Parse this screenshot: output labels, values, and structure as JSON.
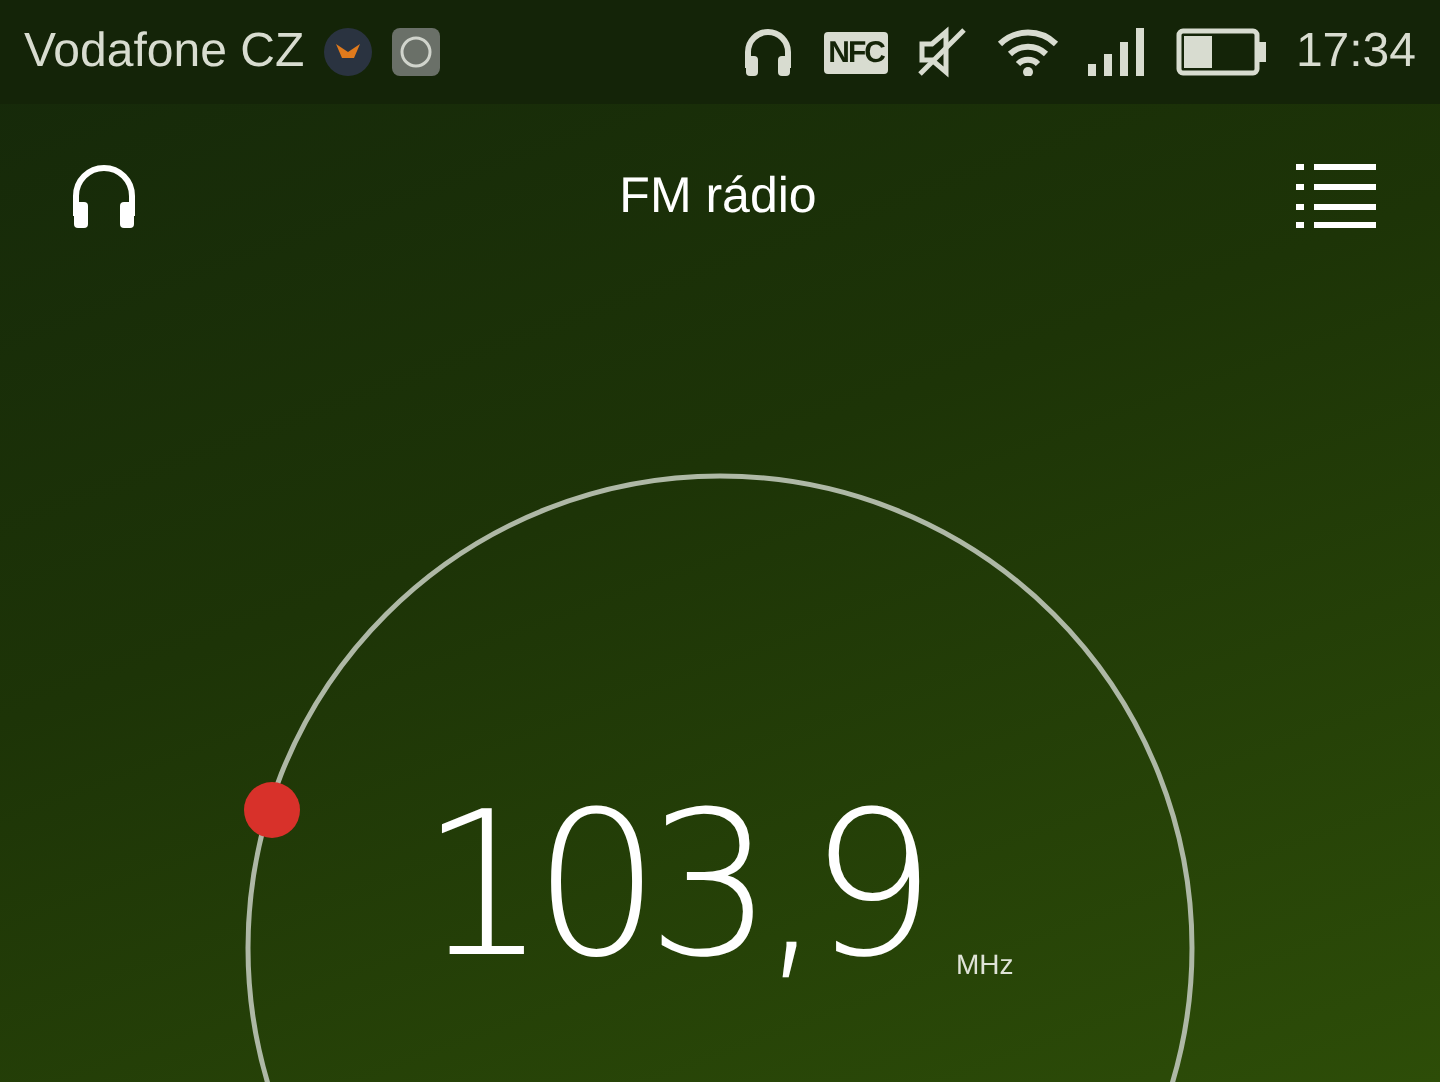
{
  "status_bar": {
    "carrier": "Vodafone CZ",
    "nfc_label": "NFC",
    "time": "17:34"
  },
  "app_bar": {
    "title": "FM rádio"
  },
  "tuner": {
    "frequency": "103,9",
    "unit": "MHz"
  }
}
